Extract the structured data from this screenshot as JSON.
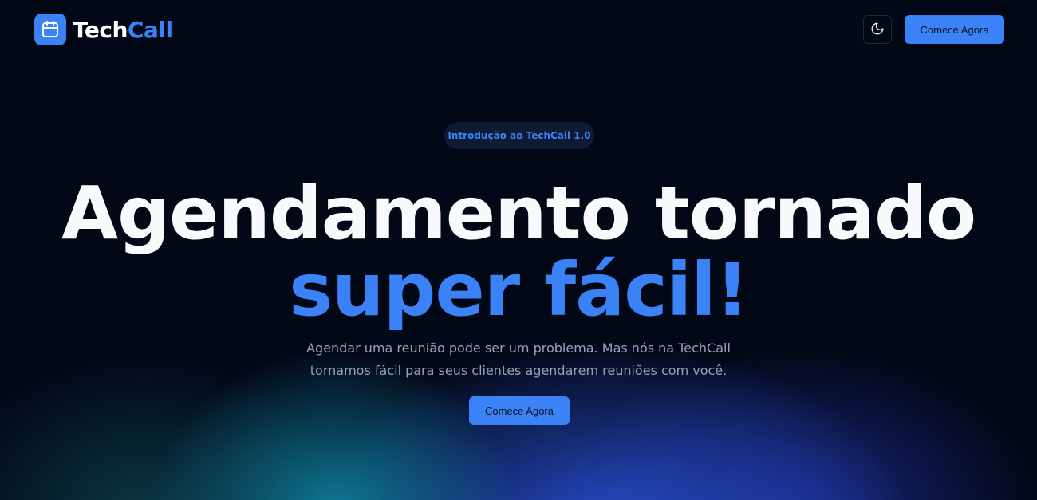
{
  "header": {
    "logo_text_main": "Tech",
    "logo_text_accent": "Call",
    "logo_icon": "calendar-icon",
    "theme_icon": "moon-icon",
    "cta_label": "Comece Agora"
  },
  "hero": {
    "badge": "Introdução ao TechCall 1.0",
    "title_line1": "Agendamento tornado",
    "title_line2": "super fácil!",
    "subtitle_line1": "Agendar uma reunião pode ser um problema. Mas nós na TechCall",
    "subtitle_line2": "tornamos fácil para seus clientes agendarem reuniões com você.",
    "cta_label": "Comece Agora"
  },
  "colors": {
    "background": "#030817",
    "accent": "#3b82f6",
    "text_primary": "#f8fafc",
    "text_muted": "#94a3b8"
  }
}
